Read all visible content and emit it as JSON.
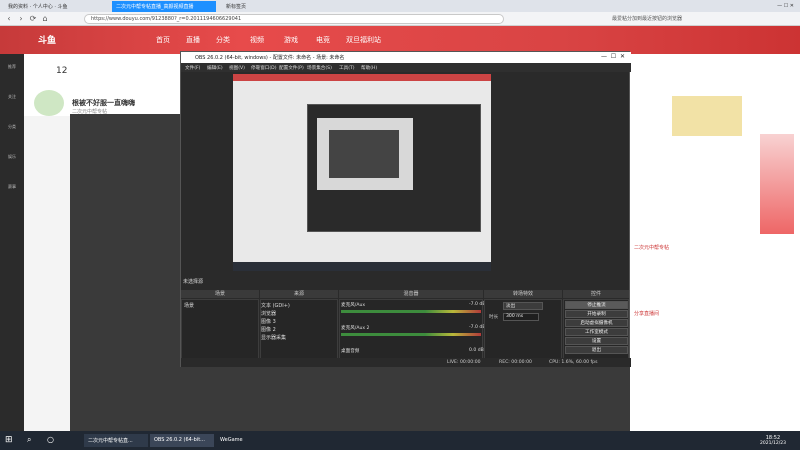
{
  "browser": {
    "tabs": [
      "我的资料 · 个人中心 · 斗鱼",
      "二次元中帮专帖直播_高颜视频直播",
      "新标签页"
    ],
    "url": "https://www.douyu.com/9123880?_r=0.2011194606629041",
    "bookmarks_hint": "最爱粘分加到最近按钮的浏览器"
  },
  "douyu": {
    "nav": [
      "首页",
      "直播",
      "分类",
      "视频",
      "游戏",
      "电竞",
      "双旦福利站"
    ],
    "stream_title": "根被不好服一直嗨嗨",
    "anchor": "二次元中帮专帖",
    "viewers": "12",
    "side": [
      "推荐",
      "关注",
      "分类",
      "娱乐",
      "赛事"
    ],
    "right_notes": [
      "二次元中帮专帖",
      "分享直播间"
    ]
  },
  "obs": {
    "title": "OBS 26.0.2 (64-bit, windows) - 配置文件: 未命名 - 场景: 未命名",
    "menu": [
      "文件(F)",
      "编辑(E)",
      "视图(V)",
      "停靠窗口(D)",
      "配置文件(P)",
      "场景集合(S)",
      "工具(T)",
      "帮助(H)"
    ],
    "no_source": "未选择源",
    "docks": [
      "场景",
      "来源",
      "混音器",
      "转场特效",
      "控件"
    ],
    "scene": "场景",
    "sources": [
      "文本 (GDI+)",
      "浏览器",
      "图像 3",
      "图像 2",
      "显示器采集"
    ],
    "mixer": [
      {
        "name": "麦克风/Aux",
        "db": "-7.0 dB"
      },
      {
        "name": "麦克风/Aux 2",
        "db": "-7.0 dB"
      },
      {
        "name": "桌面音频",
        "db": "0.0 dB"
      }
    ],
    "transition": "淡出",
    "duration_label": "时长",
    "duration": "300 ms",
    "controls": [
      "停止推流",
      "开始录制",
      "启动虚拟摄像机",
      "工作室模式",
      "设置",
      "退出"
    ],
    "status": {
      "live": "LIVE: 00:00:00",
      "rec": "REC: 00:00:00",
      "cpu": "CPU: 1.6%, 60.00 fps"
    }
  },
  "taskbar": {
    "items": [
      "二次元中帮专帖直...",
      "OBS 26.0.2 (64-bit...",
      "WeGame"
    ],
    "time": "18:52",
    "date": "2021/12/23"
  }
}
